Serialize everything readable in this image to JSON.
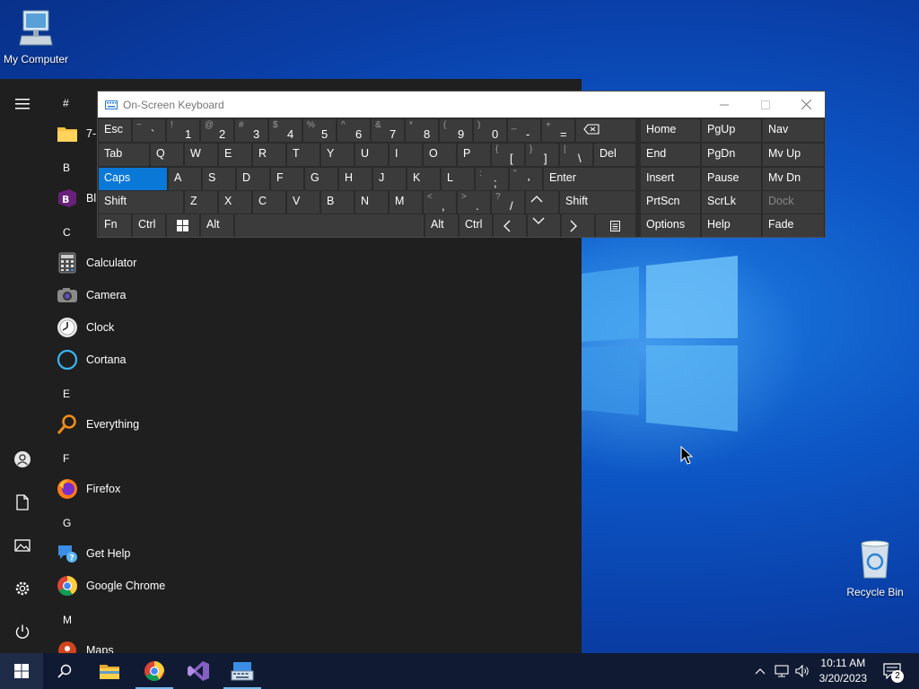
{
  "desktop": {
    "icons": [
      {
        "label": "My Computer",
        "icon": "computer-icon"
      },
      {
        "label": "Recycle Bin",
        "icon": "recycle-bin-icon"
      }
    ]
  },
  "start_menu": {
    "rail": [
      "hamburger-icon",
      "user-icon",
      "documents-icon",
      "pictures-icon",
      "settings-icon",
      "power-icon"
    ],
    "groups": [
      {
        "letter": "#"
      },
      {
        "letter": "B"
      },
      {
        "letter": "C"
      },
      {
        "letter": "E"
      },
      {
        "letter": "F"
      },
      {
        "letter": "G"
      },
      {
        "letter": "M"
      }
    ],
    "apps": {
      "sevenzip": "7-",
      "blend": "Bl",
      "calculator": "Calculator",
      "camera": "Camera",
      "clock": "Clock",
      "cortana": "Cortana",
      "everything": "Everything",
      "firefox": "Firefox",
      "get_help": "Get Help",
      "chrome": "Google Chrome",
      "maps": "Maps"
    }
  },
  "osk": {
    "title": "On-Screen Keyboard",
    "row1": {
      "esc": "Esc",
      "tilde": [
        "~",
        "`"
      ],
      "d1": [
        "!",
        "1"
      ],
      "d2": [
        "@",
        "2"
      ],
      "d3": [
        "#",
        "3"
      ],
      "d4": [
        "$",
        "4"
      ],
      "d5": [
        "%",
        "5"
      ],
      "d6": [
        "^",
        "6"
      ],
      "d7": [
        "&",
        "7"
      ],
      "d8": [
        "*",
        "8"
      ],
      "d9": [
        "(",
        "9"
      ],
      "d0": [
        ")",
        "0"
      ],
      "minus": [
        "_",
        "-"
      ],
      "equals": [
        "+",
        "="
      ]
    },
    "row2": {
      "tab": "Tab",
      "q": "Q",
      "w": "W",
      "e": "E",
      "r": "R",
      "t": "T",
      "y": "Y",
      "u": "U",
      "i": "I",
      "o": "O",
      "p": "P",
      "lbr": [
        "{",
        "["
      ],
      "rbr": [
        "}",
        "]"
      ],
      "bslash": [
        "|",
        "\\"
      ],
      "del": "Del"
    },
    "row3": {
      "caps": "Caps",
      "a": "A",
      "s": "S",
      "d": "D",
      "f": "F",
      "g": "G",
      "h": "H",
      "j": "J",
      "k": "K",
      "l": "L",
      "semi": [
        ":",
        ";"
      ],
      "quote": [
        "\"",
        "'"
      ],
      "enter": "Enter"
    },
    "row4": {
      "shift": "Shift",
      "z": "Z",
      "x": "X",
      "c": "C",
      "v": "V",
      "b": "B",
      "n": "N",
      "m": "M",
      "comma": [
        "<",
        ","
      ],
      "period": [
        ">",
        "."
      ],
      "slash": [
        "?",
        "/"
      ],
      "rshift": "Shift"
    },
    "row5": {
      "fn": "Fn",
      "ctrl": "Ctrl",
      "alt": "Alt",
      "ralt": "Alt",
      "rctrl": "Ctrl"
    },
    "nav": {
      "home": "Home",
      "pgup": "PgUp",
      "nav": "Nav",
      "end": "End",
      "pgdn": "PgDn",
      "mvup": "Mv Up",
      "insert": "Insert",
      "pause": "Pause",
      "mvdn": "Mv Dn",
      "prtscn": "PrtScn",
      "scrlk": "ScrLk",
      "dock": "Dock",
      "options": "Options",
      "help": "Help",
      "fade": "Fade"
    }
  },
  "taskbar": {
    "time": "10:11 AM",
    "date": "3/20/2023",
    "notification_count": "2"
  },
  "colors": {
    "accent": "#0a78d7",
    "taskbar": "#101b33",
    "start_bg": "#1f1f1f",
    "key_bg": "#3b3b3b"
  }
}
